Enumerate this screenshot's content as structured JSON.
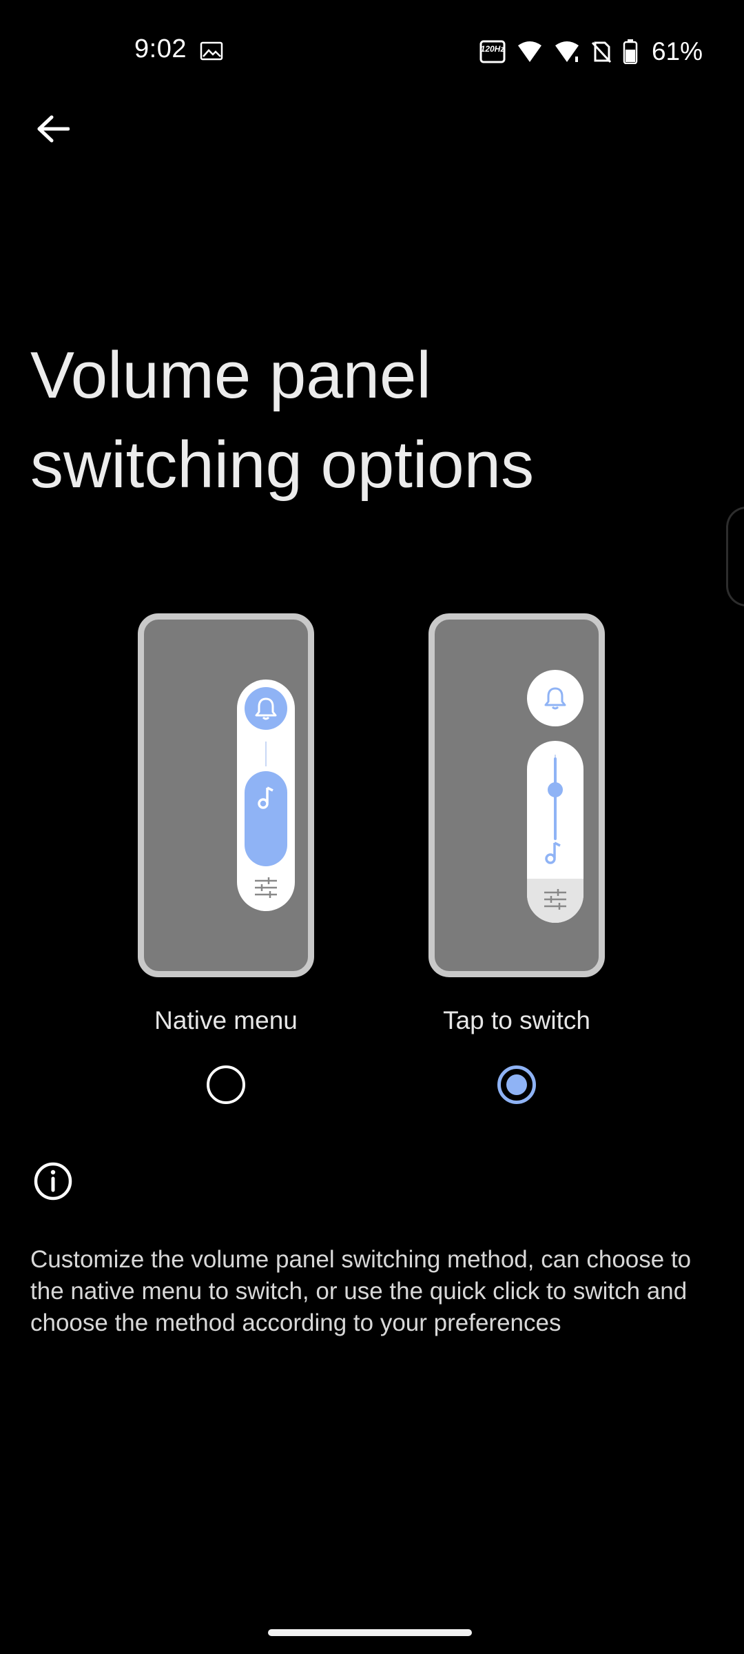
{
  "status_bar": {
    "time": "9:02",
    "refresh_rate_label": "120Hz",
    "battery_percent": "61%"
  },
  "page": {
    "title": "Volume panel switching options"
  },
  "options": [
    {
      "label": "Native menu",
      "selected": false
    },
    {
      "label": "Tap to switch",
      "selected": true
    }
  ],
  "info": {
    "text": "Customize the volume panel switching method, can choose to the native menu to switch, or use the quick click to switch and choose the method according to your preferences"
  },
  "colors": {
    "accent": "#8fb3f5",
    "background": "#000000",
    "frame": "#c9c9c9",
    "screen": "#7b7b7b"
  },
  "icons": {
    "back": "arrow-back-icon",
    "info": "info-icon",
    "bell": "bell-icon",
    "music": "music-note-icon",
    "tune": "tune-icon"
  }
}
